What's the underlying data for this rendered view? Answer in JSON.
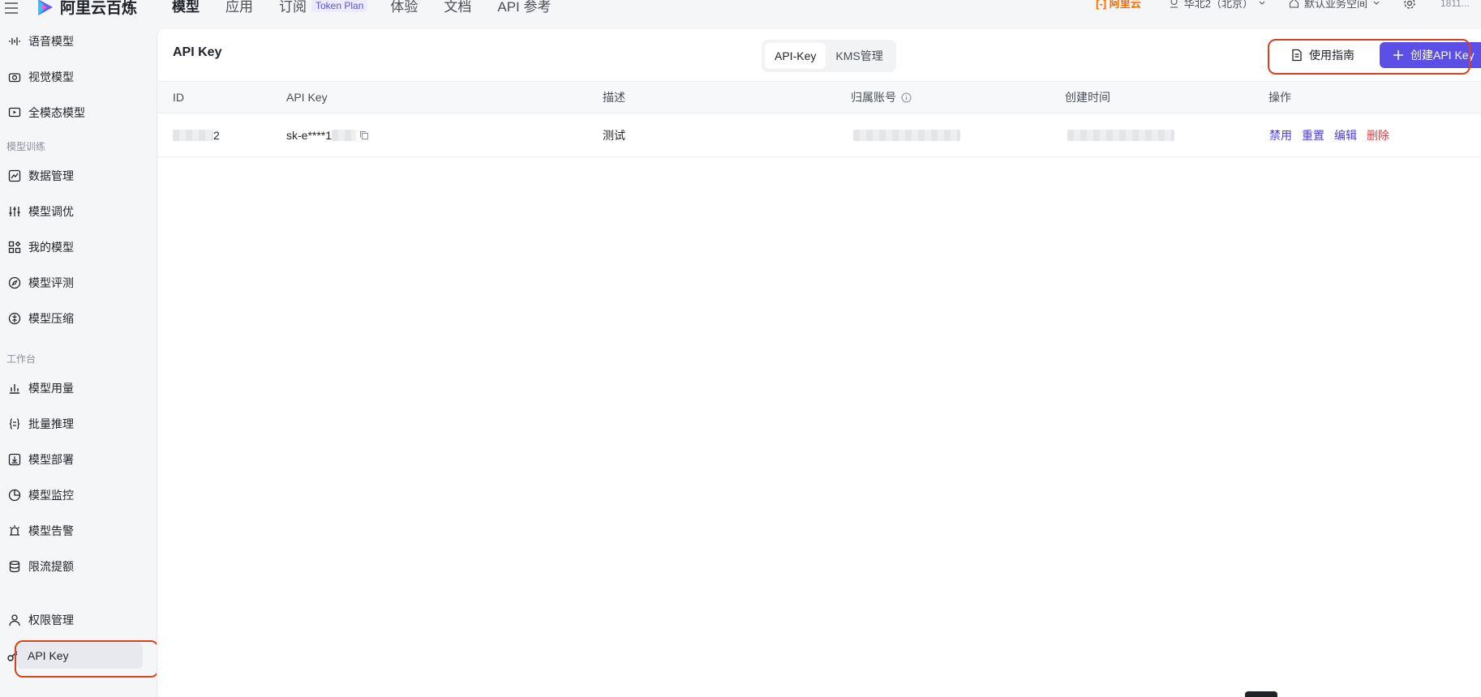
{
  "topbar": {
    "brand": "阿里云百炼",
    "nav": [
      {
        "label": "模型"
      },
      {
        "label": "应用"
      },
      {
        "label": "订阅"
      },
      {
        "label": "体验"
      },
      {
        "label": "文档"
      },
      {
        "label": "API 参考"
      }
    ],
    "subscribe_badge": "Token Plan",
    "aliyun": "阿里云",
    "region": "华北2（北京）",
    "workspace": "默认业务空间",
    "account": "1811..."
  },
  "sidebar": {
    "items_top": [
      "语音模型",
      "视觉模型",
      "全模态模型"
    ],
    "group_training": "模型训练",
    "items_training": [
      "数据管理",
      "模型调优",
      "我的模型",
      "模型评测",
      "模型压缩"
    ],
    "group_workbench": "工作台",
    "items_workbench": [
      "模型用量",
      "批量推理",
      "模型部署",
      "模型监控",
      "模型告警",
      "限流提额"
    ],
    "items_bottom": [
      "权限管理",
      "API Key"
    ]
  },
  "main": {
    "title": "API Key",
    "tabs": [
      "API-Key",
      "KMS管理"
    ],
    "guide_label": "使用指南",
    "create_label": "创建API Key"
  },
  "table": {
    "columns": [
      "ID",
      "API Key",
      "描述",
      "归属账号",
      "创建时间",
      "操作"
    ],
    "rows": [
      {
        "id_suffix": "2",
        "api_key": "sk-e****1",
        "desc": "测试",
        "actions": [
          "禁用",
          "重置",
          "编辑",
          "删除"
        ]
      }
    ]
  },
  "colors": {
    "accent": "#5b4fe8",
    "danger": "#e23b3b",
    "highlight": "#d9421e",
    "brand_orange": "#ff6a00"
  }
}
